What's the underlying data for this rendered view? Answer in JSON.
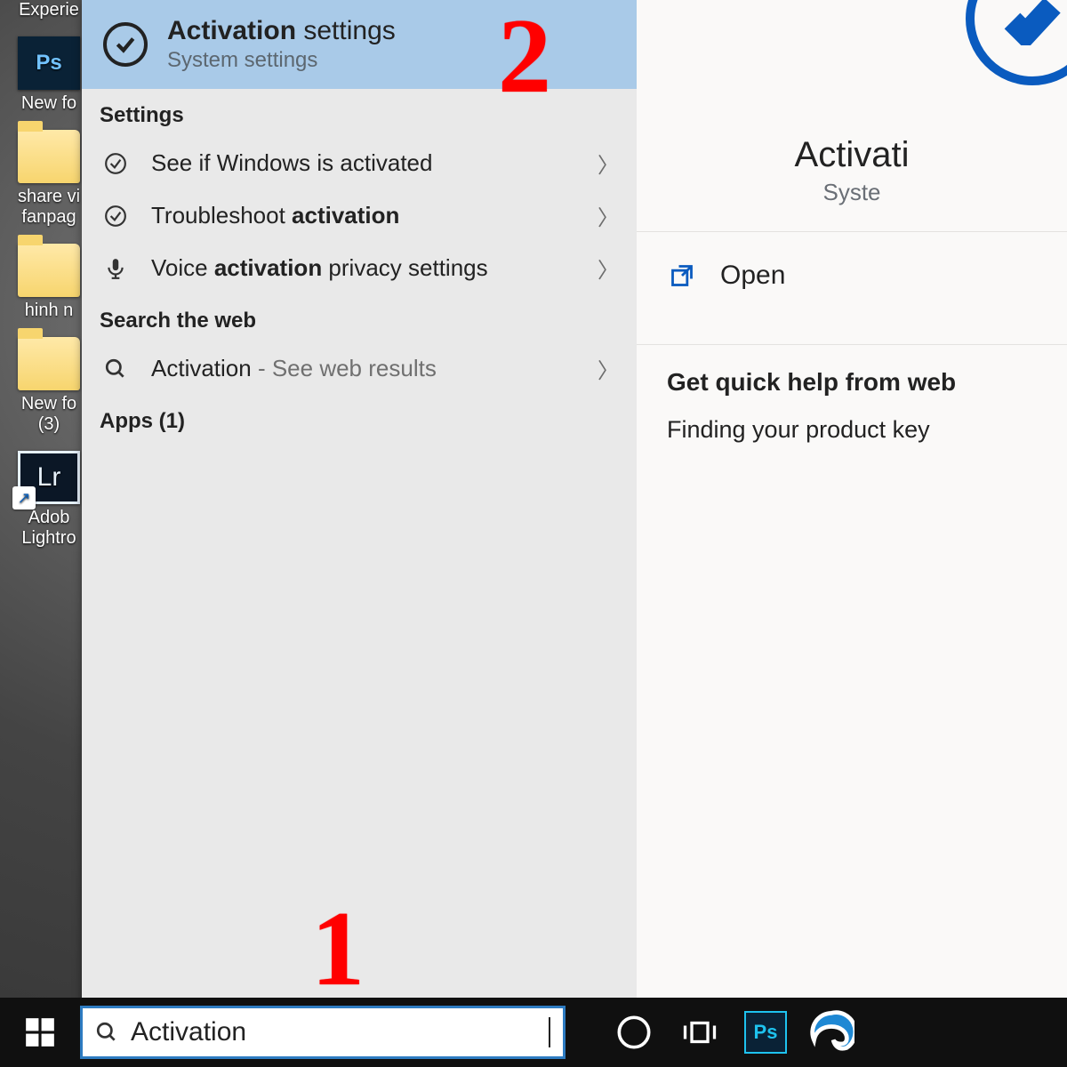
{
  "desktop_icons": [
    {
      "label": "Experie"
    },
    {
      "label": "New fo"
    },
    {
      "label": "share vi\nfanpag"
    },
    {
      "label": "hinh n"
    },
    {
      "label": "New fo\n(3)"
    },
    {
      "label": "Adob\nLightro"
    }
  ],
  "ps_badge": "Ps",
  "lr_badge": "Lr",
  "best_match": {
    "title_bold": "Activation",
    "title_rest": " settings",
    "subtitle": "System settings"
  },
  "sections": {
    "settings_header": "Settings",
    "settings_items": [
      {
        "text": "See if Windows is activated",
        "bold": ""
      },
      {
        "pre": "Troubleshoot ",
        "bold": "activation",
        "post": ""
      },
      {
        "pre": "Voice ",
        "bold": "activation",
        "post": " privacy settings"
      }
    ],
    "web_header": "Search the web",
    "web_item": {
      "term": "Activation",
      "hint": " - See web results"
    },
    "apps_header": "Apps (1)"
  },
  "detail": {
    "title": "Activati",
    "subtitle": "Syste",
    "open": "Open",
    "help_header": "Get quick help from web",
    "help_link": "Finding your product key"
  },
  "search_query": "Activation",
  "annotations": {
    "one": "1",
    "two": "2"
  }
}
